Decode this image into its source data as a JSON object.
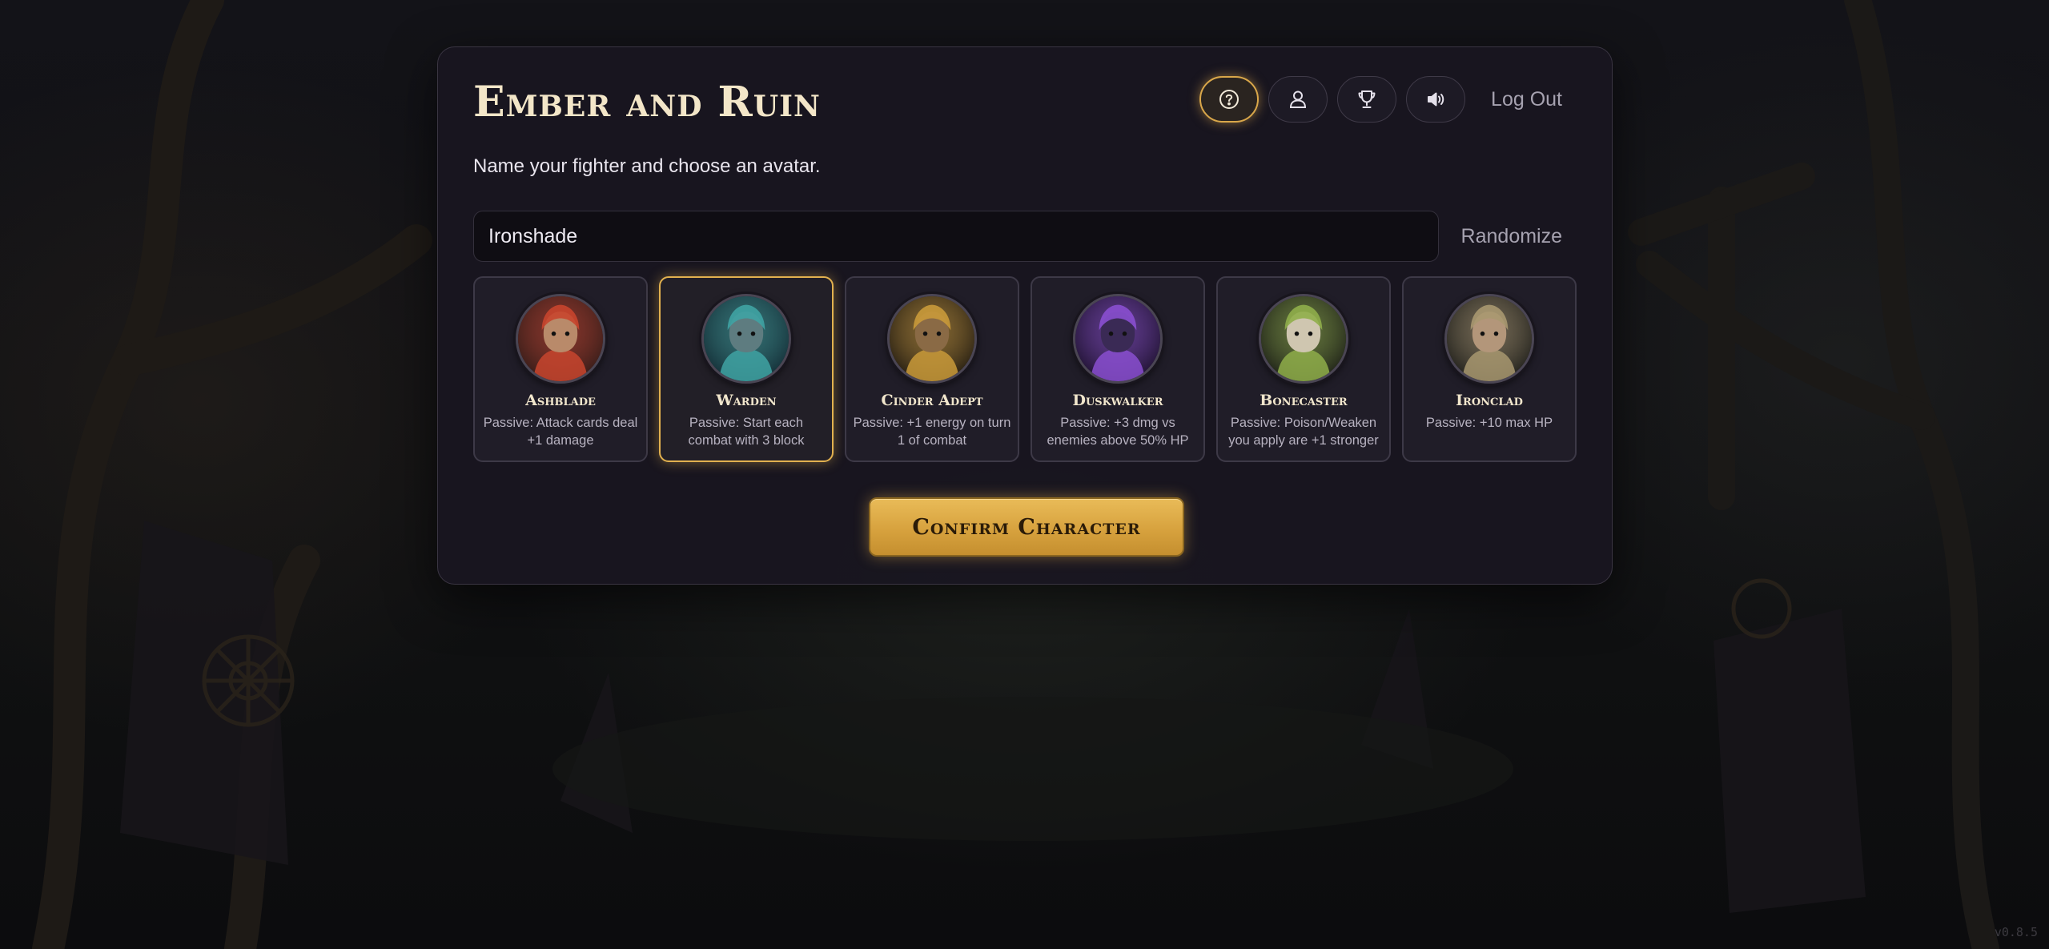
{
  "app": {
    "title": "Ember and Ruin",
    "version": "v0.8.5"
  },
  "header": {
    "buttons": [
      {
        "icon": "help-circle-icon",
        "active": true
      },
      {
        "icon": "user-icon",
        "active": false
      },
      {
        "icon": "trophy-icon",
        "active": false
      },
      {
        "icon": "speaker-icon",
        "active": false
      }
    ],
    "logout_label": "Log Out"
  },
  "character": {
    "instructions": "Name your fighter and choose an avatar.",
    "name_value": "Ironshade",
    "randomize_label": "Randomize",
    "confirm_label": "Confirm Character",
    "selected_avatar": "Warden"
  },
  "avatars": [
    {
      "name": "Ashblade",
      "passive": "Passive: Attack cards deal +1 damage",
      "palette": {
        "bg": "#3a1e1a",
        "accent": "#c8452e",
        "face": "#b98a6a"
      }
    },
    {
      "name": "Warden",
      "passive": "Passive: Start each combat with 3 block",
      "palette": {
        "bg": "#16323a",
        "accent": "#3fa3a3",
        "face": "#5e7c80"
      }
    },
    {
      "name": "Cinder Adept",
      "passive": "Passive: +1 energy on turn 1 of combat",
      "palette": {
        "bg": "#2b2214",
        "accent": "#c99a3a",
        "face": "#8a6a45"
      }
    },
    {
      "name": "Duskwalker",
      "passive": "Passive: +3 dmg vs enemies above 50% HP",
      "palette": {
        "bg": "#231536",
        "accent": "#8a4fd0",
        "face": "#3a2a55"
      }
    },
    {
      "name": "Bonecaster",
      "passive": "Passive: Poison/Weaken you apply are +1 stronger",
      "palette": {
        "bg": "#22261a",
        "accent": "#8fae4a",
        "face": "#cfc6b0"
      }
    },
    {
      "name": "Ironclad",
      "passive": "Passive: +10 max HP",
      "palette": {
        "bg": "#25241f",
        "accent": "#a89870",
        "face": "#b3967a"
      }
    }
  ]
}
